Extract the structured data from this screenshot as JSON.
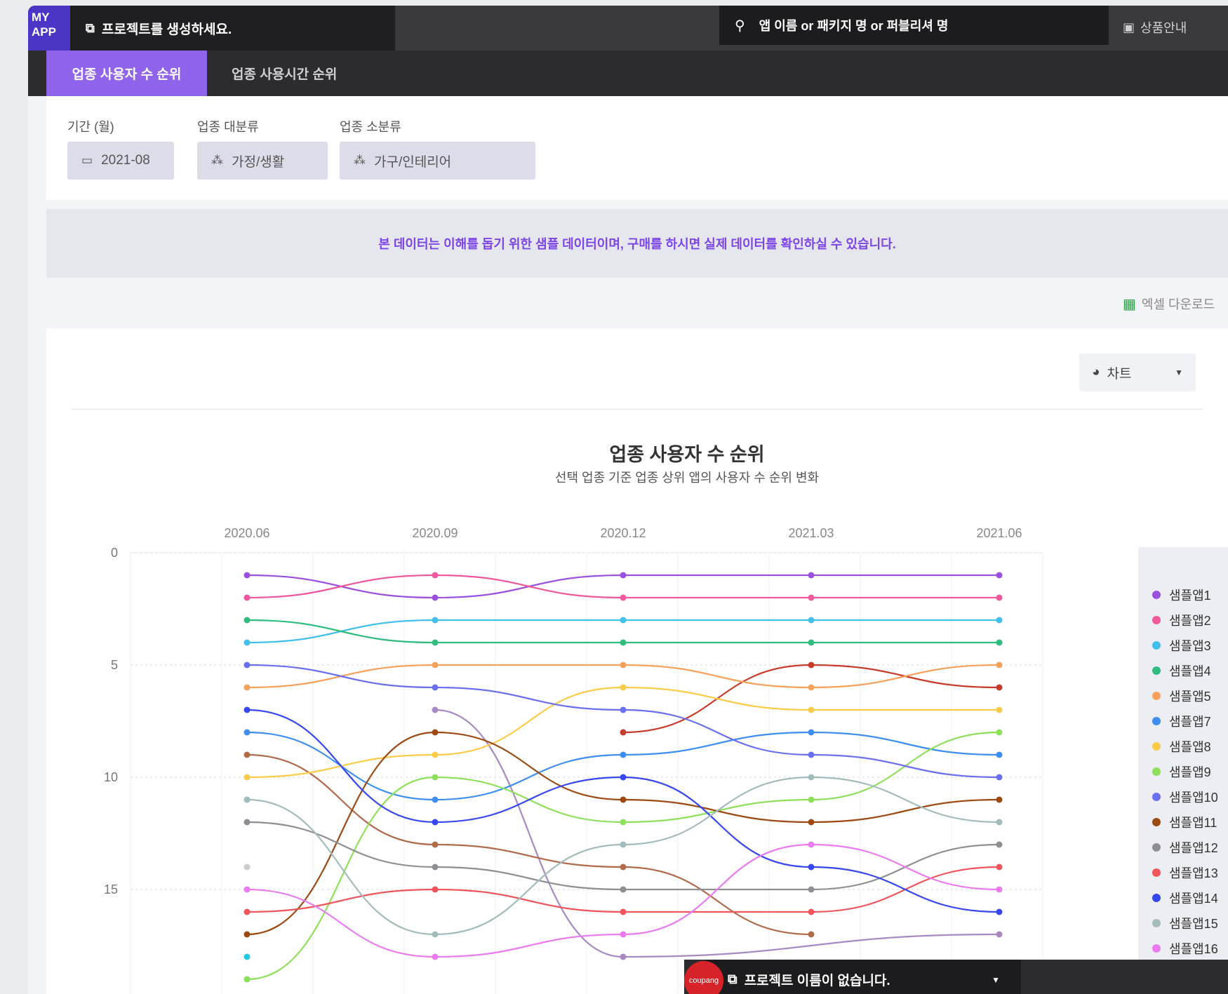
{
  "header": {
    "logo": "MY\nAPP",
    "project_label": "프로젝트를 생성하세요.",
    "search_placeholder": "앱 이름 or 패키지 명 or 퍼블리셔 명",
    "product_info": "상품안내"
  },
  "tabs": [
    {
      "label": "업종 사용자 수 순위",
      "active": true
    },
    {
      "label": "업종 사용시간 순위",
      "active": false
    }
  ],
  "filters": [
    {
      "label": "기간 (월)",
      "value": "2021-08",
      "icon": "calendar-icon"
    },
    {
      "label": "업종 대분류",
      "value": "가정/생활",
      "icon": "category-icon"
    },
    {
      "label": "업종 소분류",
      "value": "가구/인테리어",
      "icon": "category-icon"
    }
  ],
  "notice": "본 데이터는 이해를 돕기 위한 샘플 데이터이며, 구매를 하시면 실제 데이터를 확인하실 수 있습니다.",
  "excel_download": "엑셀 다운로드",
  "view_select": {
    "value": "차트"
  },
  "bottom_bar": {
    "project_label": "프로젝트 이름이 없습니다.",
    "badge": "coupang"
  },
  "colors": {
    "accent": "#8f63ea",
    "notice_text": "#7b45e8"
  },
  "chart_data": {
    "type": "line",
    "title": "업종 사용자 수 순위",
    "subtitle": "선택 업종 기준 업종 상위 앱의 사용자 수 순위 변화",
    "x": [
      "2020.06",
      "2020.09",
      "2020.12",
      "2021.03",
      "2021.06"
    ],
    "y_ticks": [
      0,
      5,
      10,
      15
    ],
    "ylim": [
      0,
      18.3
    ],
    "y_reversed": true,
    "legend_position": "right",
    "series": [
      {
        "name": "샘플앱1",
        "color": "#9b51e0",
        "values": [
          1,
          2,
          1,
          1,
          1
        ]
      },
      {
        "name": "샘플앱2",
        "color": "#f0589e",
        "values": [
          2,
          1,
          2,
          2,
          2
        ]
      },
      {
        "name": "샘플앱3",
        "color": "#40c0ea",
        "values": [
          4,
          3,
          3,
          3,
          3
        ]
      },
      {
        "name": "샘플앱4",
        "color": "#2ebd7e",
        "values": [
          3,
          4,
          4,
          4,
          4
        ]
      },
      {
        "name": "샘플앱5",
        "color": "#f7a25c",
        "values": [
          6,
          5,
          5,
          6,
          5
        ]
      },
      {
        "name": "샘플앱7",
        "color": "#3d8ef0",
        "values": [
          8,
          11,
          9,
          8,
          9
        ]
      },
      {
        "name": "샘플앱8",
        "color": "#fbcb4a",
        "values": [
          10,
          9,
          6,
          7,
          7
        ]
      },
      {
        "name": "샘플앱9",
        "color": "#8ee05a",
        "values": [
          19,
          10,
          12,
          11,
          8
        ]
      },
      {
        "name": "샘플앱10",
        "color": "#6a6ff0",
        "values": [
          5,
          6,
          7,
          9,
          10
        ]
      },
      {
        "name": "샘플앱11",
        "color": "#9c4a12",
        "values": [
          17,
          8,
          11,
          12,
          11
        ]
      },
      {
        "name": "샘플앱12",
        "color": "#8e8e93",
        "values": [
          12,
          14,
          15,
          15,
          13
        ]
      },
      {
        "name": "샘플앱13",
        "color": "#f0555b",
        "values": [
          16,
          15,
          16,
          16,
          14
        ]
      },
      {
        "name": "샘플앱14",
        "color": "#3646f0",
        "values": [
          7,
          12,
          10,
          14,
          16
        ]
      },
      {
        "name": "샘플앱15",
        "color": "#a2bcbc",
        "values": [
          11,
          17,
          13,
          10,
          12
        ]
      },
      {
        "name": "샘플앱16",
        "color": "#ea7cf0",
        "values": [
          15,
          18,
          17,
          13,
          15
        ]
      }
    ],
    "partial_series_visible": [
      {
        "color": "#c83a2a",
        "values": [
          null,
          null,
          8,
          5,
          6
        ]
      },
      {
        "color": "#a78ac4",
        "values": [
          null,
          7,
          18,
          null,
          17
        ]
      },
      {
        "color": "#b06b4a",
        "values": [
          9,
          13,
          14,
          17,
          null
        ]
      },
      {
        "color": "#cccccc",
        "values": [
          14,
          null,
          null,
          null,
          null
        ]
      },
      {
        "color": "#22c9e0",
        "values": [
          18,
          null,
          null,
          null,
          null
        ]
      }
    ]
  }
}
